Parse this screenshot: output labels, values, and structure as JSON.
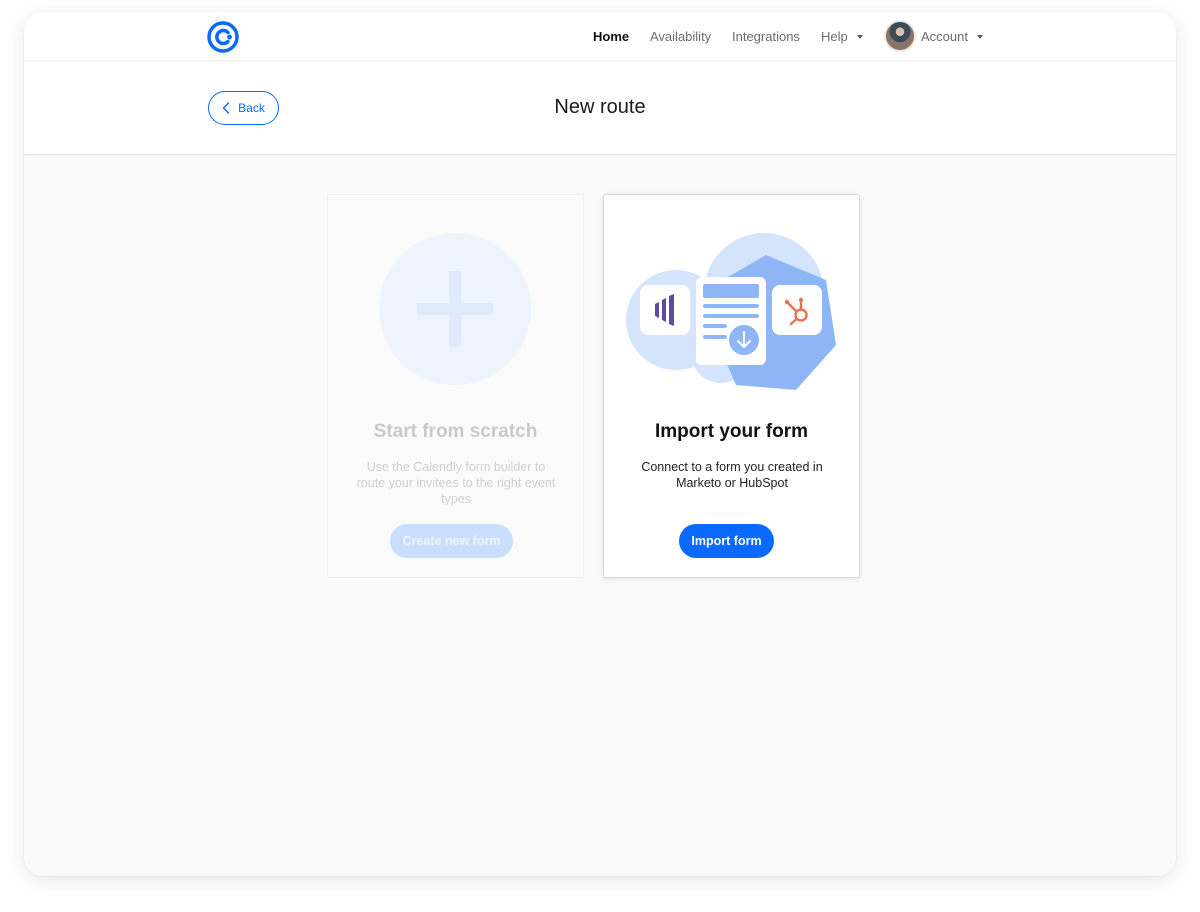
{
  "nav": {
    "items": [
      {
        "label": "Home",
        "active": true
      },
      {
        "label": "Availability",
        "active": false
      },
      {
        "label": "Integrations",
        "active": false
      },
      {
        "label": "Help",
        "active": false,
        "dropdown": true
      }
    ],
    "account_label": "Account"
  },
  "header": {
    "back_label": "Back",
    "title": "New route"
  },
  "cards": {
    "scratch": {
      "title": "Start from scratch",
      "description": "Use the Calendly form builder to route your invitees to the right event types",
      "button": "Create new form",
      "state": "disabled"
    },
    "import": {
      "title": "Import your form",
      "description": "Connect to a form you created in Marketo or HubSpot",
      "button": "Import form",
      "state": "enabled"
    }
  },
  "colors": {
    "primary": "#0a69ff",
    "disabled_button": "#c9defc",
    "page_background": "#fafafa",
    "marketo": "#5c4c9f",
    "hubspot": "#e8734d"
  },
  "icons": [
    "calendly-logo-icon",
    "chevron-left-icon",
    "chevron-down-icon",
    "plus-icon",
    "marketo-icon",
    "hubspot-icon",
    "download-arrow-icon"
  ]
}
